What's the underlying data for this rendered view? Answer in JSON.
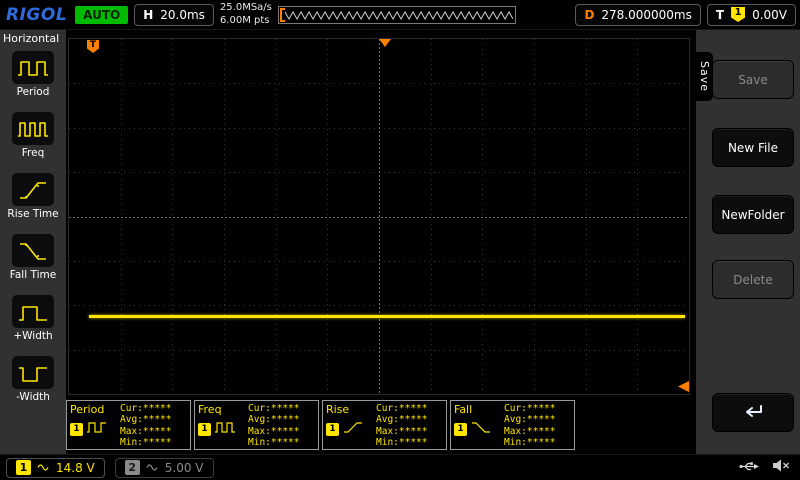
{
  "topbar": {
    "logo": "RIGOL",
    "status": "AUTO",
    "h_label": "H",
    "h_value": "20.0ms",
    "sample_rate": "25.0MSa/s",
    "mem_depth": "6.00M pts",
    "d_label": "D",
    "d_value": "278.000000ms",
    "t_label": "T",
    "t_channel": "1",
    "t_value": "0.00V"
  },
  "left_menu": {
    "title": "Horizontal",
    "items": [
      {
        "label": "Period",
        "icon": "period-icon"
      },
      {
        "label": "Freq",
        "icon": "freq-icon"
      },
      {
        "label": "Rise Time",
        "icon": "rise-time-icon"
      },
      {
        "label": "Fall Time",
        "icon": "fall-time-icon"
      },
      {
        "label": "+Width",
        "icon": "plus-width-icon"
      },
      {
        "label": "-Width",
        "icon": "minus-width-icon"
      }
    ]
  },
  "display": {
    "markers": {
      "t_flag": "T"
    }
  },
  "measure_labels": {
    "cur": "Cur:",
    "avg": "Avg:",
    "max": "Max:",
    "min": "Min:"
  },
  "measurements": [
    {
      "name": "Period",
      "channel": "1",
      "icon": "period-wave-icon",
      "cur": "*****",
      "avg": "*****",
      "max": "*****",
      "min": "*****"
    },
    {
      "name": "Freq",
      "channel": "1",
      "icon": "freq-wave-icon",
      "cur": "*****",
      "avg": "*****",
      "max": "*****",
      "min": "*****"
    },
    {
      "name": "Rise",
      "channel": "1",
      "icon": "rise-wave-icon",
      "cur": "*****",
      "avg": "*****",
      "max": "*****",
      "min": "*****"
    },
    {
      "name": "Fall",
      "channel": "1",
      "icon": "fall-wave-icon",
      "cur": "*****",
      "avg": "*****",
      "max": "*****",
      "min": "*****"
    }
  ],
  "right_menu": {
    "tab": "Save",
    "buttons": [
      {
        "label": "Save",
        "enabled": false
      },
      {
        "label": "New File",
        "enabled": true
      },
      {
        "label": "NewFolder",
        "enabled": true
      },
      {
        "label": "Delete",
        "enabled": false
      }
    ],
    "return_button_icon": "return-arrow"
  },
  "channels": [
    {
      "id": "1",
      "scale": "14.8 V",
      "active": true
    },
    {
      "id": "2",
      "scale": "5.00 V",
      "active": false
    }
  ],
  "icons": {
    "coupling": "sine-wave",
    "usb": "usb-plug",
    "speaker": "speaker-muted",
    "memory_bracket": "orange-left-bracket"
  },
  "colors": {
    "trace": "#ffe600",
    "trigger_orange": "#ff8000",
    "ch1": "#ffe600",
    "ch2": "#8a8a8a",
    "status_green": "#00bb00",
    "logo_blue": "#2e6bdc",
    "panel_gray": "#313131"
  }
}
